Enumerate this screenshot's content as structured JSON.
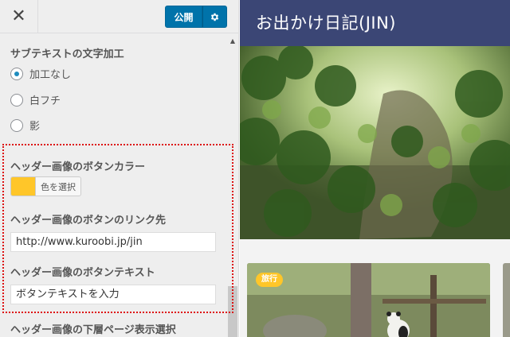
{
  "topbar": {
    "close_icon": "close-icon",
    "publish_label": "公開",
    "settings_icon": "gear-icon",
    "accent_color": "#0073aa"
  },
  "subtext_section": {
    "title": "サブテキストの文字加工",
    "options": [
      {
        "label": "加工なし",
        "checked": true
      },
      {
        "label": "白フチ",
        "checked": false
      },
      {
        "label": "影",
        "checked": false
      }
    ]
  },
  "button_color": {
    "title": "ヘッダー画像のボタンカラー",
    "picker_label": "色を選択",
    "swatch_color": "#ffc629"
  },
  "button_link": {
    "title": "ヘッダー画像のボタンのリンク先",
    "value": "http://www.kuroobi.jp/jin"
  },
  "button_text": {
    "title": "ヘッダー画像のボタンテキスト",
    "value": "ボタンテキストを入力"
  },
  "lower_page": {
    "title": "ヘッダー画像の下層ページ表示選択"
  },
  "preview": {
    "site_title": "お出かけ日記(JIN)",
    "header_color": "#3b4675",
    "card_tag": "旅行",
    "tag_color": "#ffc629"
  }
}
